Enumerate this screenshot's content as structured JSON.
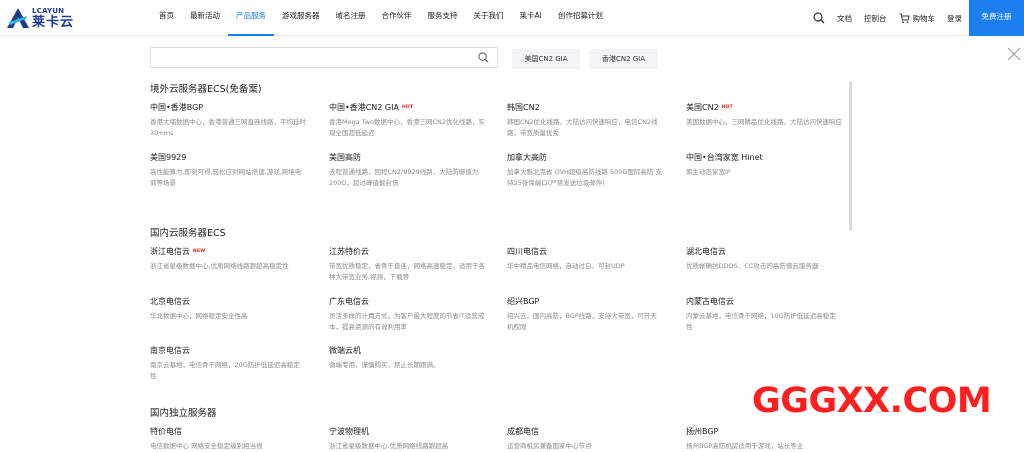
{
  "brand": {
    "logo_en": "LCAYUN",
    "logo_cn": "莱卡云",
    "color": "#1f3c88"
  },
  "nav": {
    "items": [
      "首页",
      "最新活动",
      "产品服务",
      "游戏服务器",
      "域名注册",
      "合作伙伴",
      "服务支持",
      "关于我们",
      "莱卡AI",
      "创作招募计划"
    ],
    "active_index": 2,
    "accent": "#1c7ff0"
  },
  "tools": {
    "docs": "文档",
    "console": "控制台",
    "cart": "购物车",
    "login": "登录",
    "register": "免费注册"
  },
  "search": {
    "value": "",
    "placeholder": ""
  },
  "pills": [
    "美国CN2 GIA",
    "香港CN2 GIA"
  ],
  "sections": [
    {
      "title": "境外云服务器ECS(免备案)",
      "items": [
        {
          "name": "中国•香港BGP",
          "desc": "香港大埔数据中心，香港普通三网直连线路，平均延时30+ms"
        },
        {
          "name": "中国•香港CN2 GIA",
          "badge": "HOT",
          "desc": "香港Mega Two数据中心，香港三网CN2优化线路，实现全国超低延迟"
        },
        {
          "name": "韩国CN2",
          "desc": "韩国CN2优化线路，大陆访问快速响应，电信CN2线路，带宽质量优秀"
        },
        {
          "name": "美国CN2",
          "badge": "HOT",
          "desc": "美国数据中心，三网精品优化线路，大陆访问快速响应"
        },
        {
          "name": "美国9929",
          "desc": "高性能算力,即刻可得,轻松应对网站搭建,游戏,跨境电商等场景"
        },
        {
          "name": "美国高防",
          "desc": "去程普通线路，回程CN2/9929线路，大陆防御值为200G，超过峰值解封快"
        },
        {
          "name": "加拿大高防",
          "desc": "加拿大魁北克省 OVH超级高防线路 500G国际高防 支持25张保端口(严禁发送垃圾邮件)"
        },
        {
          "name": "中国•台湾家宽 Hinet",
          "desc": "原生动态家宽IP"
        }
      ]
    },
    {
      "title": "国内云服务器ECS",
      "items": [
        {
          "name": "浙江电信云",
          "badge": "NEW",
          "desc": "浙江省星级数据中心,优质网络线路跟超高稳定性"
        },
        {
          "name": "江苏特价云",
          "desc": "带宽优质稳定，省骨干直连，网络高速稳定，适用于各种大带宽业务,视频，下载等"
        },
        {
          "name": "四川电信云",
          "desc": "华中精品电信网络，自动过白，可封UDP"
        },
        {
          "name": "湖北电信云",
          "desc": "优质帐确抗DDOS、CC攻击的高防御云服务器"
        },
        {
          "name": "北京电信云",
          "desc": "华北数据中心，网络稳定安全性高"
        },
        {
          "name": "广东电信云",
          "desc": "灵活多样的计费方式，为客户最大程度的节省IT运营成本，提高资源的有效利用率"
        },
        {
          "name": "绍兴BGP",
          "desc": "绍兴云，国内高防，BGP线路，支持大带宽，可开天机权限"
        },
        {
          "name": "内蒙古电信云",
          "desc": "内蒙云基地，电信骨干网络，10G防护低延迟高稳定性"
        },
        {
          "name": "南京电信云",
          "desc": "南京云基地，电信骨干网络，20G防护低延迟高稳定性"
        },
        {
          "name": "微端云机",
          "desc": "微端专用，谨慎购买，禁止长期跑满。"
        }
      ]
    },
    {
      "title": "国内独立服务器",
      "items": [
        {
          "name": "特价电信",
          "desc": "电信数据中心 网络安全稳定级别相当很"
        },
        {
          "name": "宁波物理机",
          "desc": "浙江省星级数据中心,优质网络线路跟超高"
        },
        {
          "name": "成都电信",
          "desc": "运营商机房兼备国家中心节点"
        },
        {
          "name": "扬州BGP",
          "desc": "扬州BGP高防机房适用于游戏，站长等业"
        }
      ]
    }
  ],
  "watermark": "GGGXX.COM",
  "watermark_color": "#ff1f1f"
}
